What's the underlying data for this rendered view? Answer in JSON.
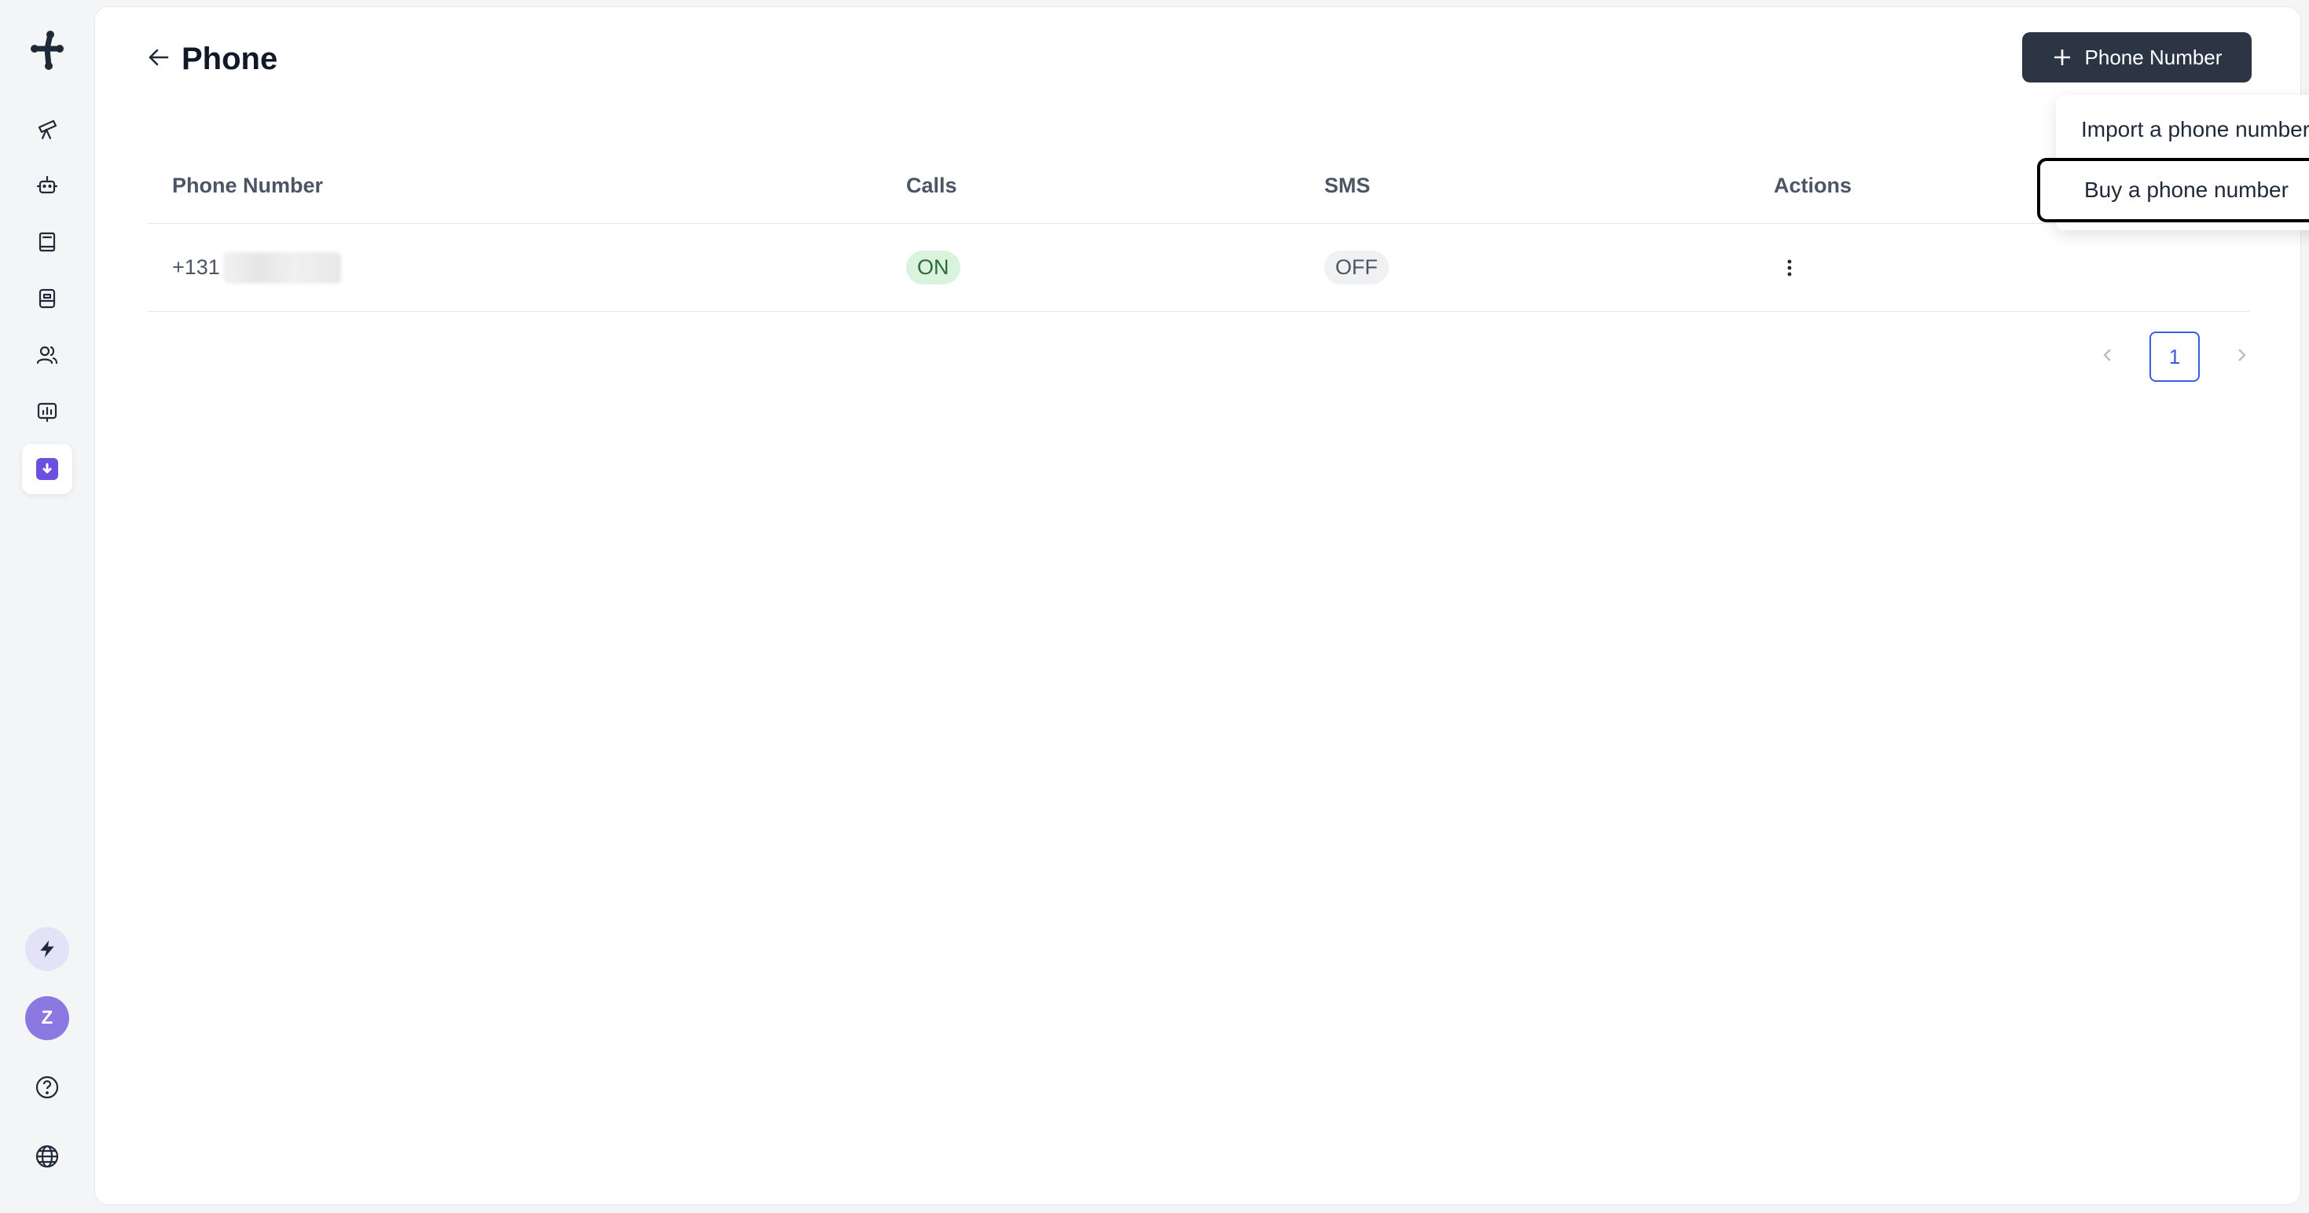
{
  "header": {
    "title": "Phone",
    "add_button_label": "Phone Number"
  },
  "dropdown": {
    "items": [
      {
        "label": "Import a phone number"
      },
      {
        "label": "Buy a phone number",
        "highlighted": true
      }
    ]
  },
  "table": {
    "columns": [
      "Phone Number",
      "Calls",
      "SMS",
      "Actions"
    ],
    "rows": [
      {
        "phone_visible_prefix": "+131",
        "calls": "ON",
        "sms": "OFF"
      }
    ]
  },
  "pagination": {
    "current_page": "1"
  },
  "sidebar": {
    "avatar_initial": "Z",
    "items": [
      {
        "icon": "telescope-icon"
      },
      {
        "icon": "robot-icon"
      },
      {
        "icon": "book-icon"
      },
      {
        "icon": "database-icon"
      },
      {
        "icon": "users-icon"
      },
      {
        "icon": "chart-icon"
      },
      {
        "icon": "download-box-icon",
        "active": true
      }
    ]
  },
  "colors": {
    "accent": "#6d4fe0",
    "primary_button": "#2b3544",
    "on_badge": "#d9f3dc",
    "pagination_active": "#3b5ce6"
  }
}
